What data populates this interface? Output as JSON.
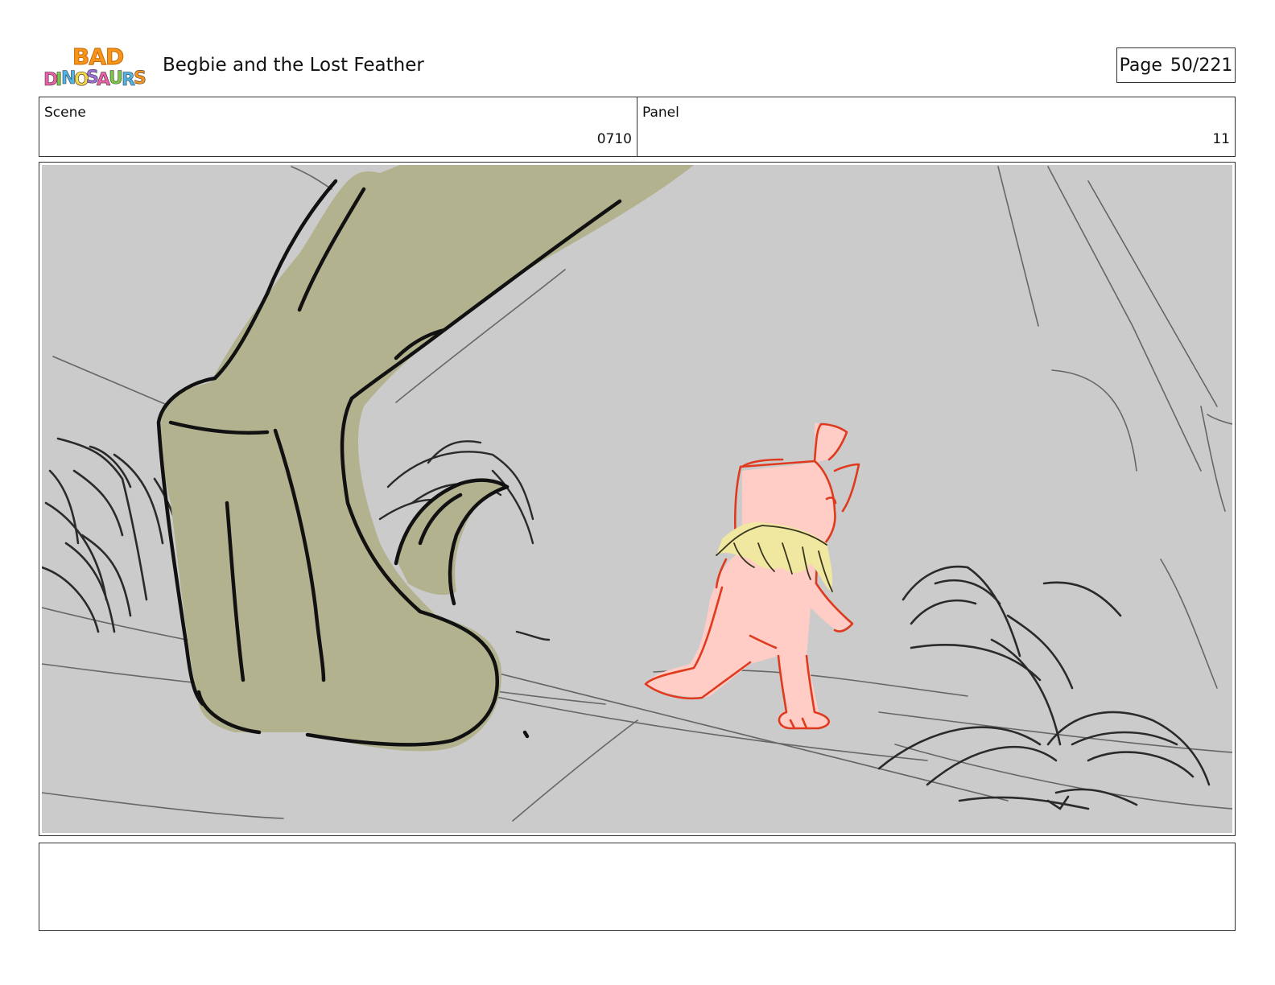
{
  "header": {
    "logo": {
      "line1": "BAD",
      "line2": "DINOSAURS",
      "colors": {
        "orange": "#f7941d",
        "pink": "#ec5fa7",
        "green": "#7ac943",
        "blue": "#4fb4e8",
        "purple": "#9b6fd6",
        "yellow": "#f9d648"
      }
    },
    "title": "Begbie and the Lost Feather",
    "page_label": "Page",
    "page_value": "50/221"
  },
  "info": {
    "scene_label": "Scene",
    "scene_value": "0710",
    "panel_label": "Panel",
    "panel_value": "11"
  },
  "panel": {
    "background": "#cbcbcb",
    "colors": {
      "giant_leg": "#b3b28f",
      "small_dino": "#ffcdc5",
      "small_dino_line": "#e03a1e",
      "mane": "#f0e8a0"
    }
  },
  "notes": {
    "text": ""
  }
}
